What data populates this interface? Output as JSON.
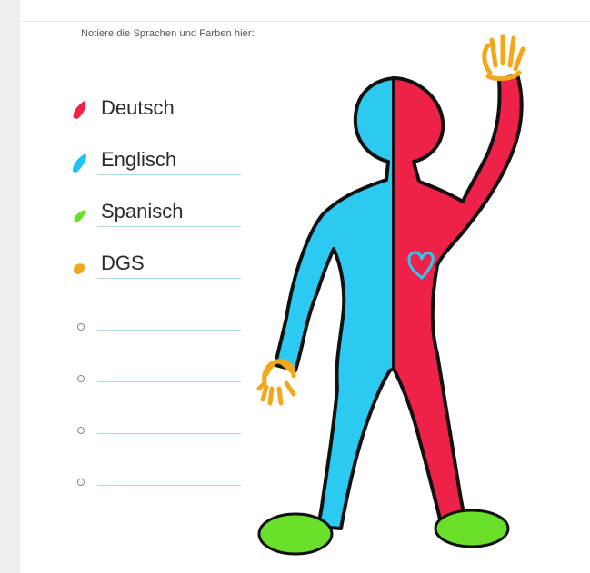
{
  "instruction": "Notiere die Sprachen und Farben hier:",
  "languages": [
    {
      "label": "Deutsch",
      "color": "#ee2148"
    },
    {
      "label": "Englisch",
      "color": "#1ec4f0"
    },
    {
      "label": "Spanisch",
      "color": "#6ae02a"
    },
    {
      "label": "DGS",
      "color": "#f3a81c"
    }
  ],
  "colors": {
    "figure_left": "#2ccaf0",
    "figure_right": "#ee2148",
    "feet": "#6ae02a",
    "hands": "#f3a81c",
    "outline": "#111111"
  }
}
